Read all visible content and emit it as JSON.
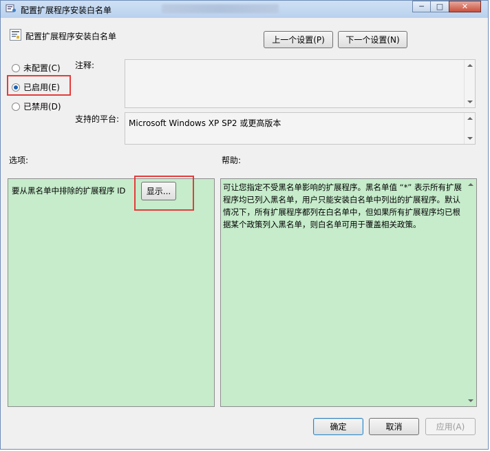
{
  "window": {
    "title": "配置扩展程序安装白名单",
    "controls": {
      "minimize": "─",
      "maximize": "□",
      "close": "✕"
    }
  },
  "header": {
    "title": "配置扩展程序安装白名单",
    "prev_label": "上一个设置(P)",
    "next_label": "下一个设置(N)"
  },
  "state": {
    "options": [
      {
        "label": "未配置(C)",
        "checked": false
      },
      {
        "label": "已启用(E)",
        "checked": true
      },
      {
        "label": "已禁用(D)",
        "checked": false
      }
    ]
  },
  "comment": {
    "label": "注释:",
    "value": ""
  },
  "platform": {
    "label": "支持的平台:",
    "value": "Microsoft Windows XP SP2 或更高版本"
  },
  "options_section": {
    "label": "选项:",
    "item_label": "要从黑名单中排除的扩展程序 ID",
    "show_button": "显示..."
  },
  "help_section": {
    "label": "帮助:",
    "text": "可让您指定不受黑名单影响的扩展程序。黑名单值 “*” 表示所有扩展程序均已列入黑名单，用户只能安装白名单中列出的扩展程序。默认情况下，所有扩展程序都列在白名单中，但如果所有扩展程序均已根据某个政策列入黑名单，则白名单可用于覆盖相关政策。"
  },
  "footer": {
    "ok": "确定",
    "cancel": "取消",
    "apply": "应用(A)"
  },
  "colors": {
    "panel_green": "#c6eccb",
    "highlight_red": "#e53a3a",
    "radio_blue": "#1a5fb4"
  },
  "icons": {
    "window_icon": "policy-window-icon",
    "header_icon": "policy-setting-icon"
  }
}
